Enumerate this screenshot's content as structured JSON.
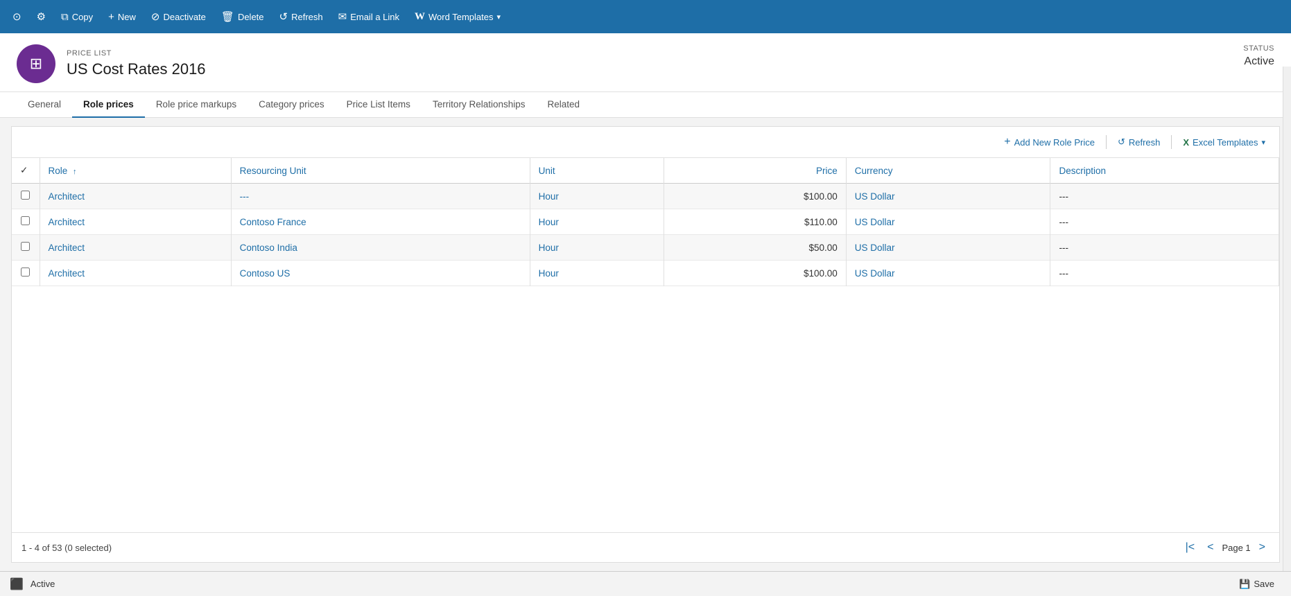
{
  "toolbar": {
    "buttons": [
      {
        "id": "copy",
        "label": "Copy",
        "icon": "⧉"
      },
      {
        "id": "new",
        "label": "New",
        "icon": "+"
      },
      {
        "id": "deactivate",
        "label": "Deactivate",
        "icon": "⊘"
      },
      {
        "id": "delete",
        "label": "Delete",
        "icon": "🗑"
      },
      {
        "id": "refresh",
        "label": "Refresh",
        "icon": "↺"
      },
      {
        "id": "email-link",
        "label": "Email a Link",
        "icon": "✉"
      },
      {
        "id": "word-templates",
        "label": "Word Templates",
        "icon": "W",
        "has_dropdown": true
      }
    ]
  },
  "entity": {
    "type_label": "PRICE LIST",
    "name": "US Cost Rates 2016",
    "icon": "⊞",
    "status_label": "Status",
    "status_value": "Active"
  },
  "tabs": [
    {
      "id": "general",
      "label": "General",
      "active": false
    },
    {
      "id": "role-prices",
      "label": "Role prices",
      "active": true
    },
    {
      "id": "role-price-markups",
      "label": "Role price markups",
      "active": false
    },
    {
      "id": "category-prices",
      "label": "Category prices",
      "active": false
    },
    {
      "id": "price-list-items",
      "label": "Price List Items",
      "active": false
    },
    {
      "id": "territory-relationships",
      "label": "Territory Relationships",
      "active": false
    },
    {
      "id": "related",
      "label": "Related",
      "active": false
    }
  ],
  "grid": {
    "toolbar": {
      "add_label": "Add New Role Price",
      "refresh_label": "Refresh",
      "excel_label": "Excel Templates"
    },
    "columns": [
      {
        "id": "check",
        "label": ""
      },
      {
        "id": "role",
        "label": "Role",
        "sortable": true
      },
      {
        "id": "resourcing-unit",
        "label": "Resourcing Unit"
      },
      {
        "id": "unit",
        "label": "Unit"
      },
      {
        "id": "price",
        "label": "Price"
      },
      {
        "id": "currency",
        "label": "Currency"
      },
      {
        "id": "description",
        "label": "Description"
      }
    ],
    "rows": [
      {
        "role": "Architect",
        "resourcing_unit": "---",
        "unit": "Hour",
        "price": "$100.00",
        "currency": "US Dollar",
        "description": "---"
      },
      {
        "role": "Architect",
        "resourcing_unit": "Contoso France",
        "unit": "Hour",
        "price": "$110.00",
        "currency": "US Dollar",
        "description": "---"
      },
      {
        "role": "Architect",
        "resourcing_unit": "Contoso India",
        "unit": "Hour",
        "price": "$50.00",
        "currency": "US Dollar",
        "description": "---"
      },
      {
        "role": "Architect",
        "resourcing_unit": "Contoso US",
        "unit": "Hour",
        "price": "$100.00",
        "currency": "US Dollar",
        "description": "---"
      }
    ],
    "pagination": {
      "summary": "1 - 4 of 53 (0 selected)",
      "page_label": "Page 1"
    }
  },
  "status_bar": {
    "status": "Active",
    "save_label": "Save"
  }
}
